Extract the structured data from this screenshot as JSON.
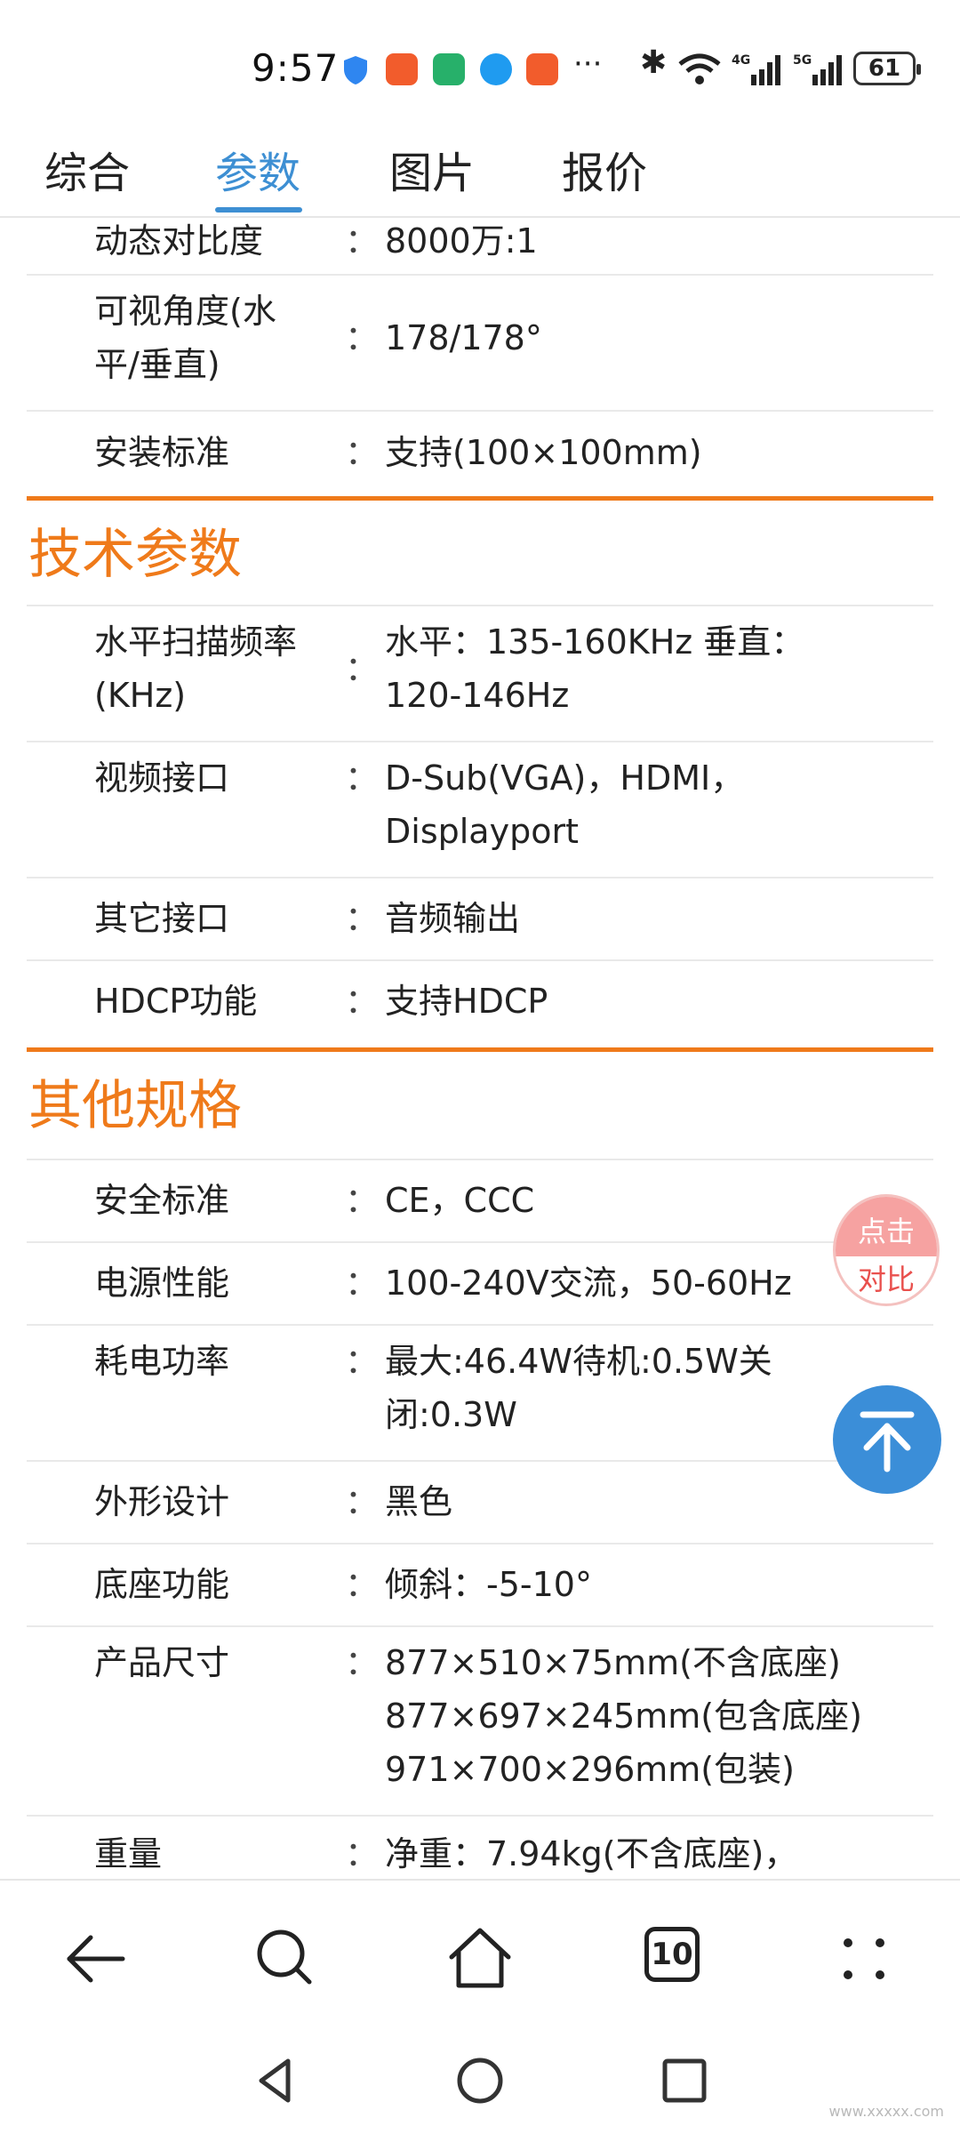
{
  "status_bar": {
    "time": "9:57",
    "battery": "61",
    "more_indicator": "···",
    "signal_1_label": "4G",
    "signal_2_label": "5G",
    "icons": [
      "shield-icon",
      "app-notification-icon",
      "app-notification-icon",
      "chat-bubble-icon",
      "app-notification-icon",
      "bluetooth-icon",
      "wifi-icon",
      "signal-4g-icon",
      "signal-5g-icon"
    ]
  },
  "tabs": [
    {
      "label": "综合",
      "active": false
    },
    {
      "label": "参数",
      "active": true
    },
    {
      "label": "图片",
      "active": false
    },
    {
      "label": "报价",
      "active": false
    }
  ],
  "colors": {
    "accent_blue": "#3d8fd3",
    "section_orange": "#ef7a1a",
    "compare_red": "#e9504d",
    "totop_blue": "#3b8ed8"
  },
  "rows_top": [
    {
      "label": "动态对比度",
      "colon": "：",
      "value": "8000万:1"
    },
    {
      "label": "可视角度(水平/垂直)",
      "colon": "：",
      "value": "178/178°"
    },
    {
      "label": "安装标准",
      "colon": "：",
      "value": "支持(100×100mm)"
    }
  ],
  "sections": [
    {
      "title": "技术参数",
      "rows": [
        {
          "label": "水平扫描频率(KHz)",
          "colon": "：",
          "value": "水平：135-160KHz 垂直：120-146Hz"
        },
        {
          "label": "视频接口",
          "colon": "：",
          "value": "D-Sub(VGA)，HDMI，Displayport"
        },
        {
          "label": "其它接口",
          "colon": "：",
          "value": "音频输出"
        },
        {
          "label": "HDCP功能",
          "colon": "：",
          "value": "支持HDCP"
        }
      ]
    },
    {
      "title": "其他规格",
      "rows": [
        {
          "label": "安全标准",
          "colon": "：",
          "value": "CE，CCC"
        },
        {
          "label": "电源性能",
          "colon": "：",
          "value": "100-240V交流，50-60Hz"
        },
        {
          "label": "耗电功率",
          "colon": "：",
          "value": "最大:46.4W待机:0.5W关闭:0.3W"
        },
        {
          "label": "外形设计",
          "colon": "：",
          "value": "黑色"
        },
        {
          "label": "底座功能",
          "colon": "：",
          "value": "倾斜：-5-10°"
        },
        {
          "label": "产品尺寸",
          "colon": "：",
          "value": "877×510×75mm(不含底座) 877×697×245mm(包含底座) 971×700×296mm(包装)"
        },
        {
          "label": "重量",
          "colon": "：",
          "value": "净重：7.94kg(不含底座)，"
        }
      ]
    }
  ],
  "compare_button": {
    "line1": "点击",
    "line2": "对比"
  },
  "back_to_top_icon": "arrow-up-to-top-icon",
  "browser_bar": {
    "icons": [
      "back-arrow-icon",
      "search-icon",
      "home-icon",
      "tabs-icon",
      "more-dots-icon"
    ],
    "tabs_count": "10"
  },
  "system_nav": {
    "icons": [
      "nav-back-icon",
      "nav-home-icon",
      "nav-recent-icon"
    ]
  },
  "watermark": "www.xxxxx.com"
}
